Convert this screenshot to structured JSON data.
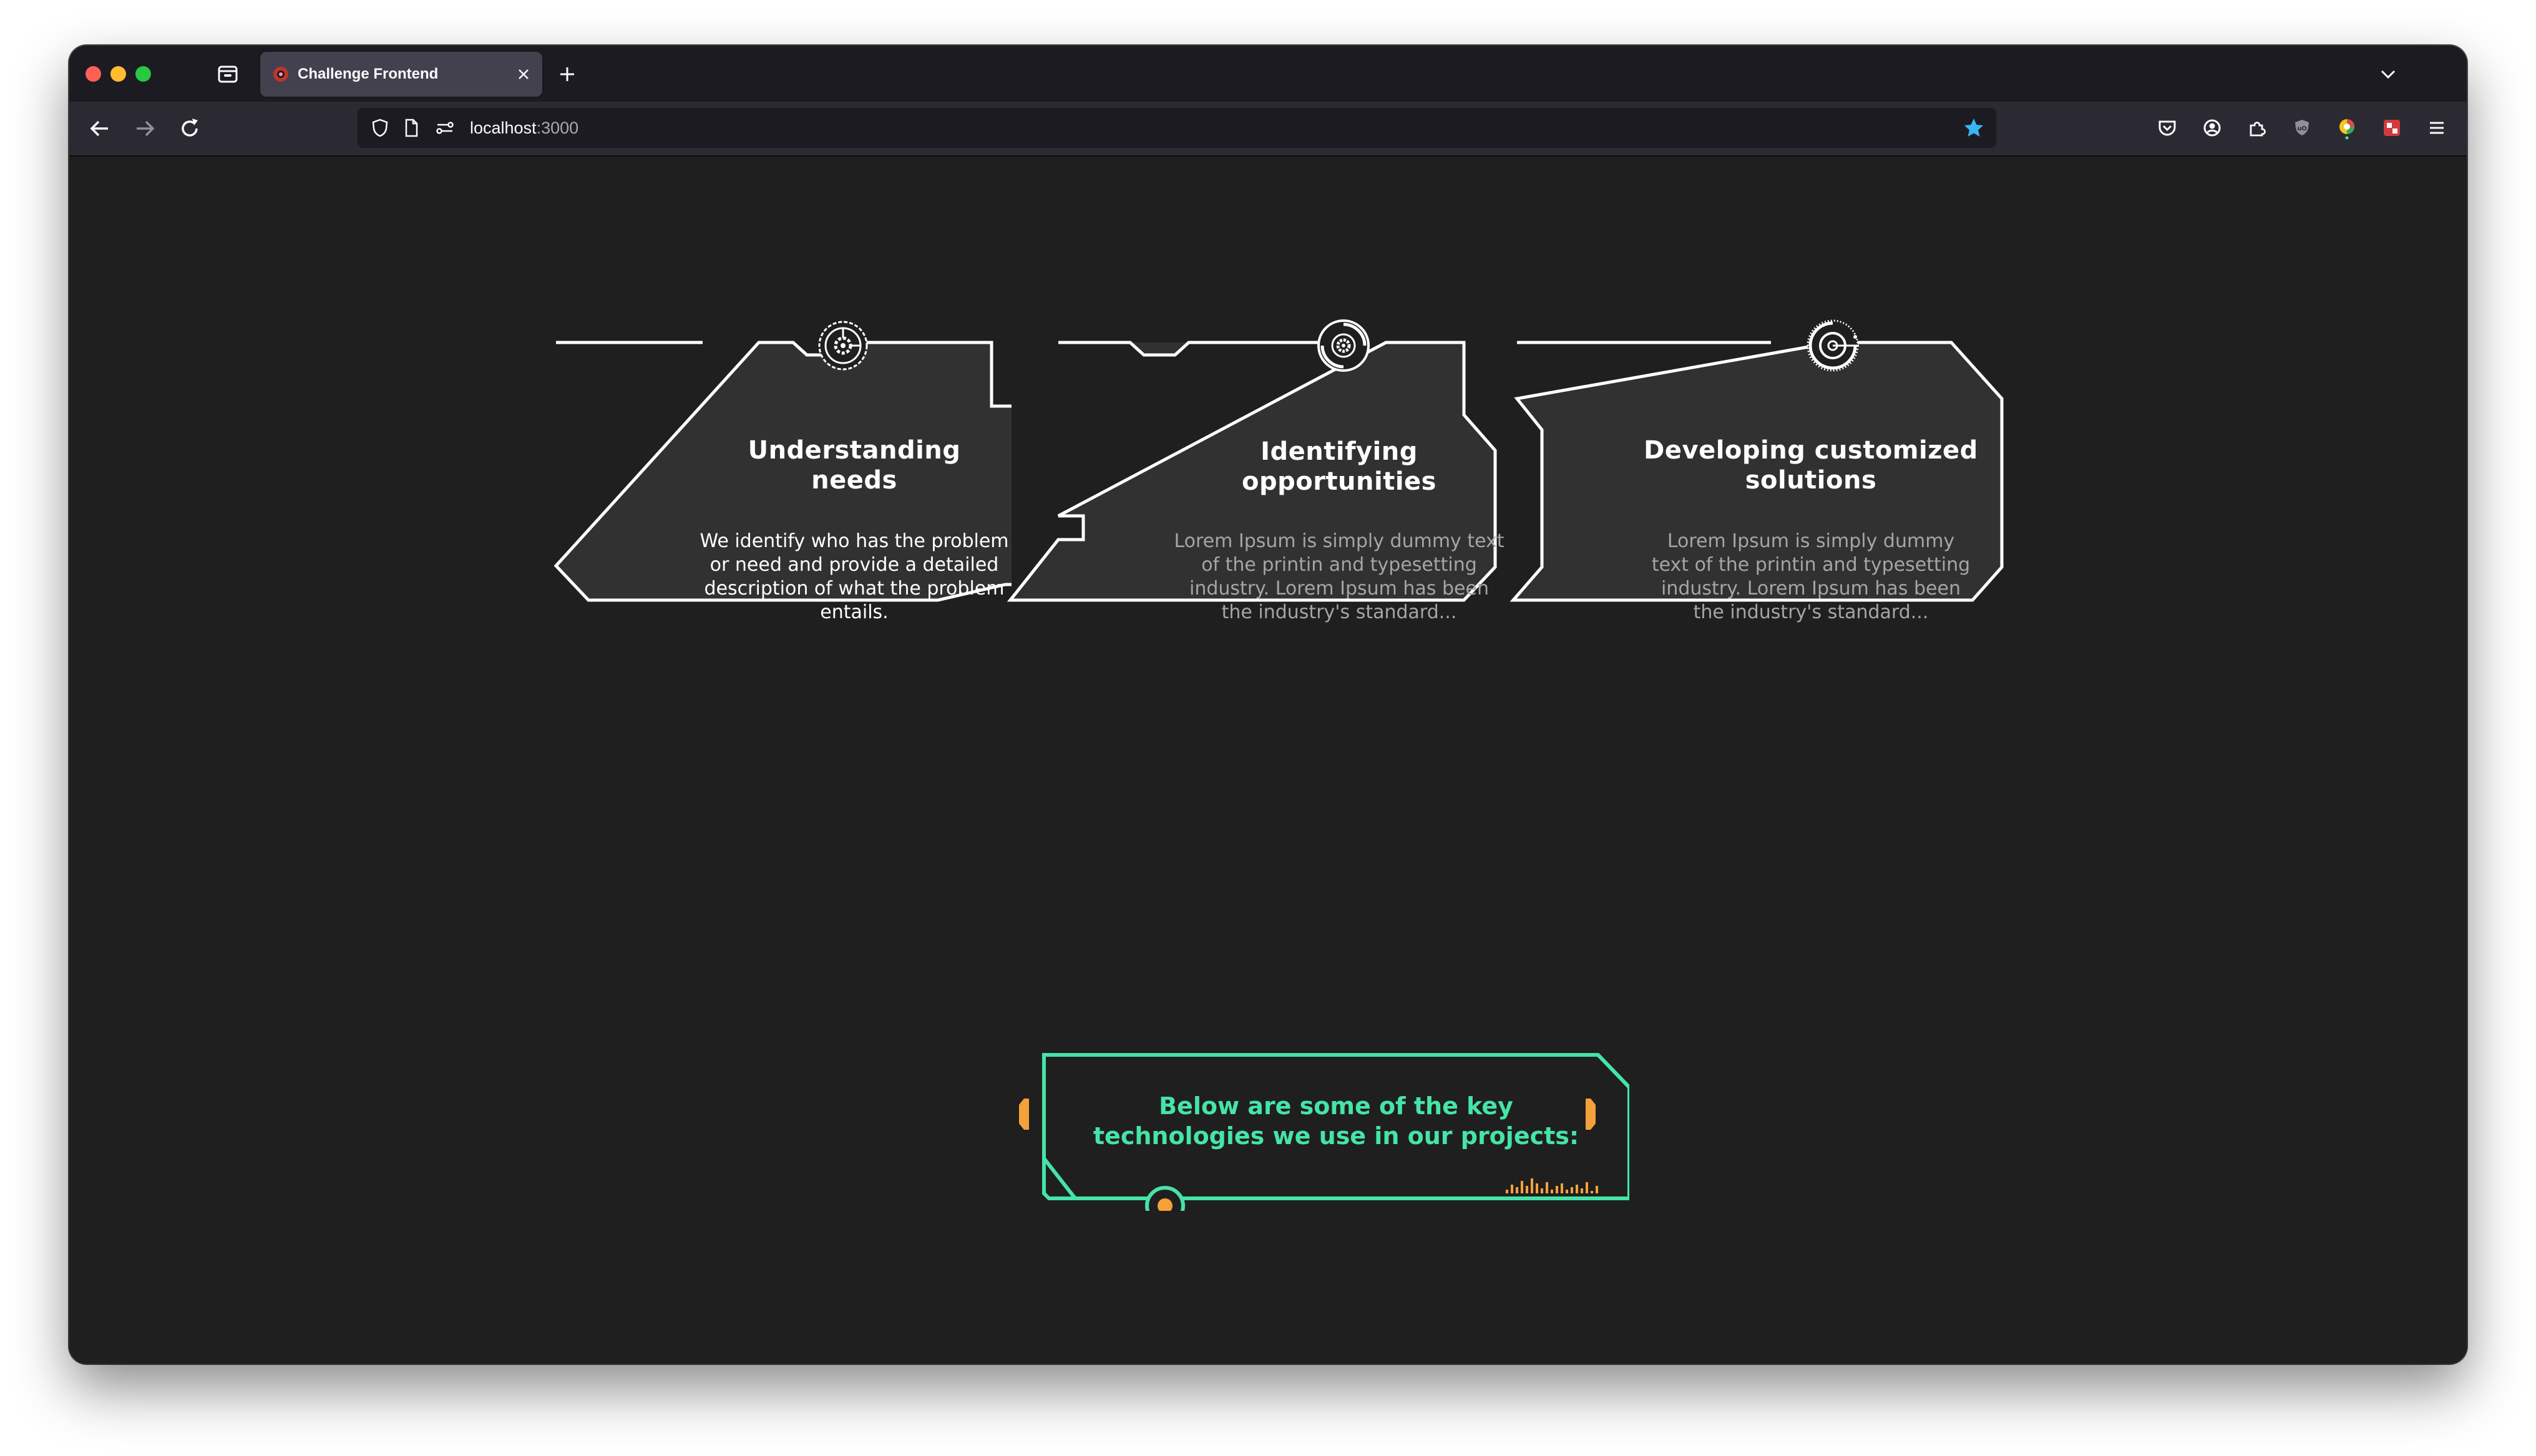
{
  "browser": {
    "tab_title": "Challenge Frontend",
    "url_host": "localhost",
    "url_port": ":3000"
  },
  "cards": [
    {
      "title_line1": "Understanding",
      "title_line2": "needs",
      "text_lines": [
        "We identify who has the problem",
        "or need and provide a detailed",
        "description of what the problem",
        "entails."
      ],
      "active": true,
      "icon": "gear-target-icon"
    },
    {
      "title_line1": "Identifying",
      "title_line2": "opportunities",
      "text_lines": [
        "Lorem Ipsum is simply dummy text",
        "of the printin and typesetting",
        "industry. Lorem Ipsum has been",
        "the industry's standard..."
      ],
      "active": false,
      "icon": "radar-icon"
    },
    {
      "title_line1": "Developing customized",
      "title_line2": "solutions",
      "text_lines": [
        "Lorem Ipsum is simply dummy",
        "text of the printin and typesetting",
        "industry. Lorem Ipsum has been",
        "the industry's standard..."
      ],
      "active": false,
      "icon": "crosshair-icon"
    }
  ],
  "tech_banner": {
    "line1": "Below are some of the key",
    "line2": "technologies we use in our projects:"
  },
  "colors": {
    "accent_green": "#45e4a7",
    "accent_orange": "#f5a13a",
    "card_fill": "#313132",
    "card_stroke": "#ffffff",
    "page_bg": "#1f1f20"
  }
}
